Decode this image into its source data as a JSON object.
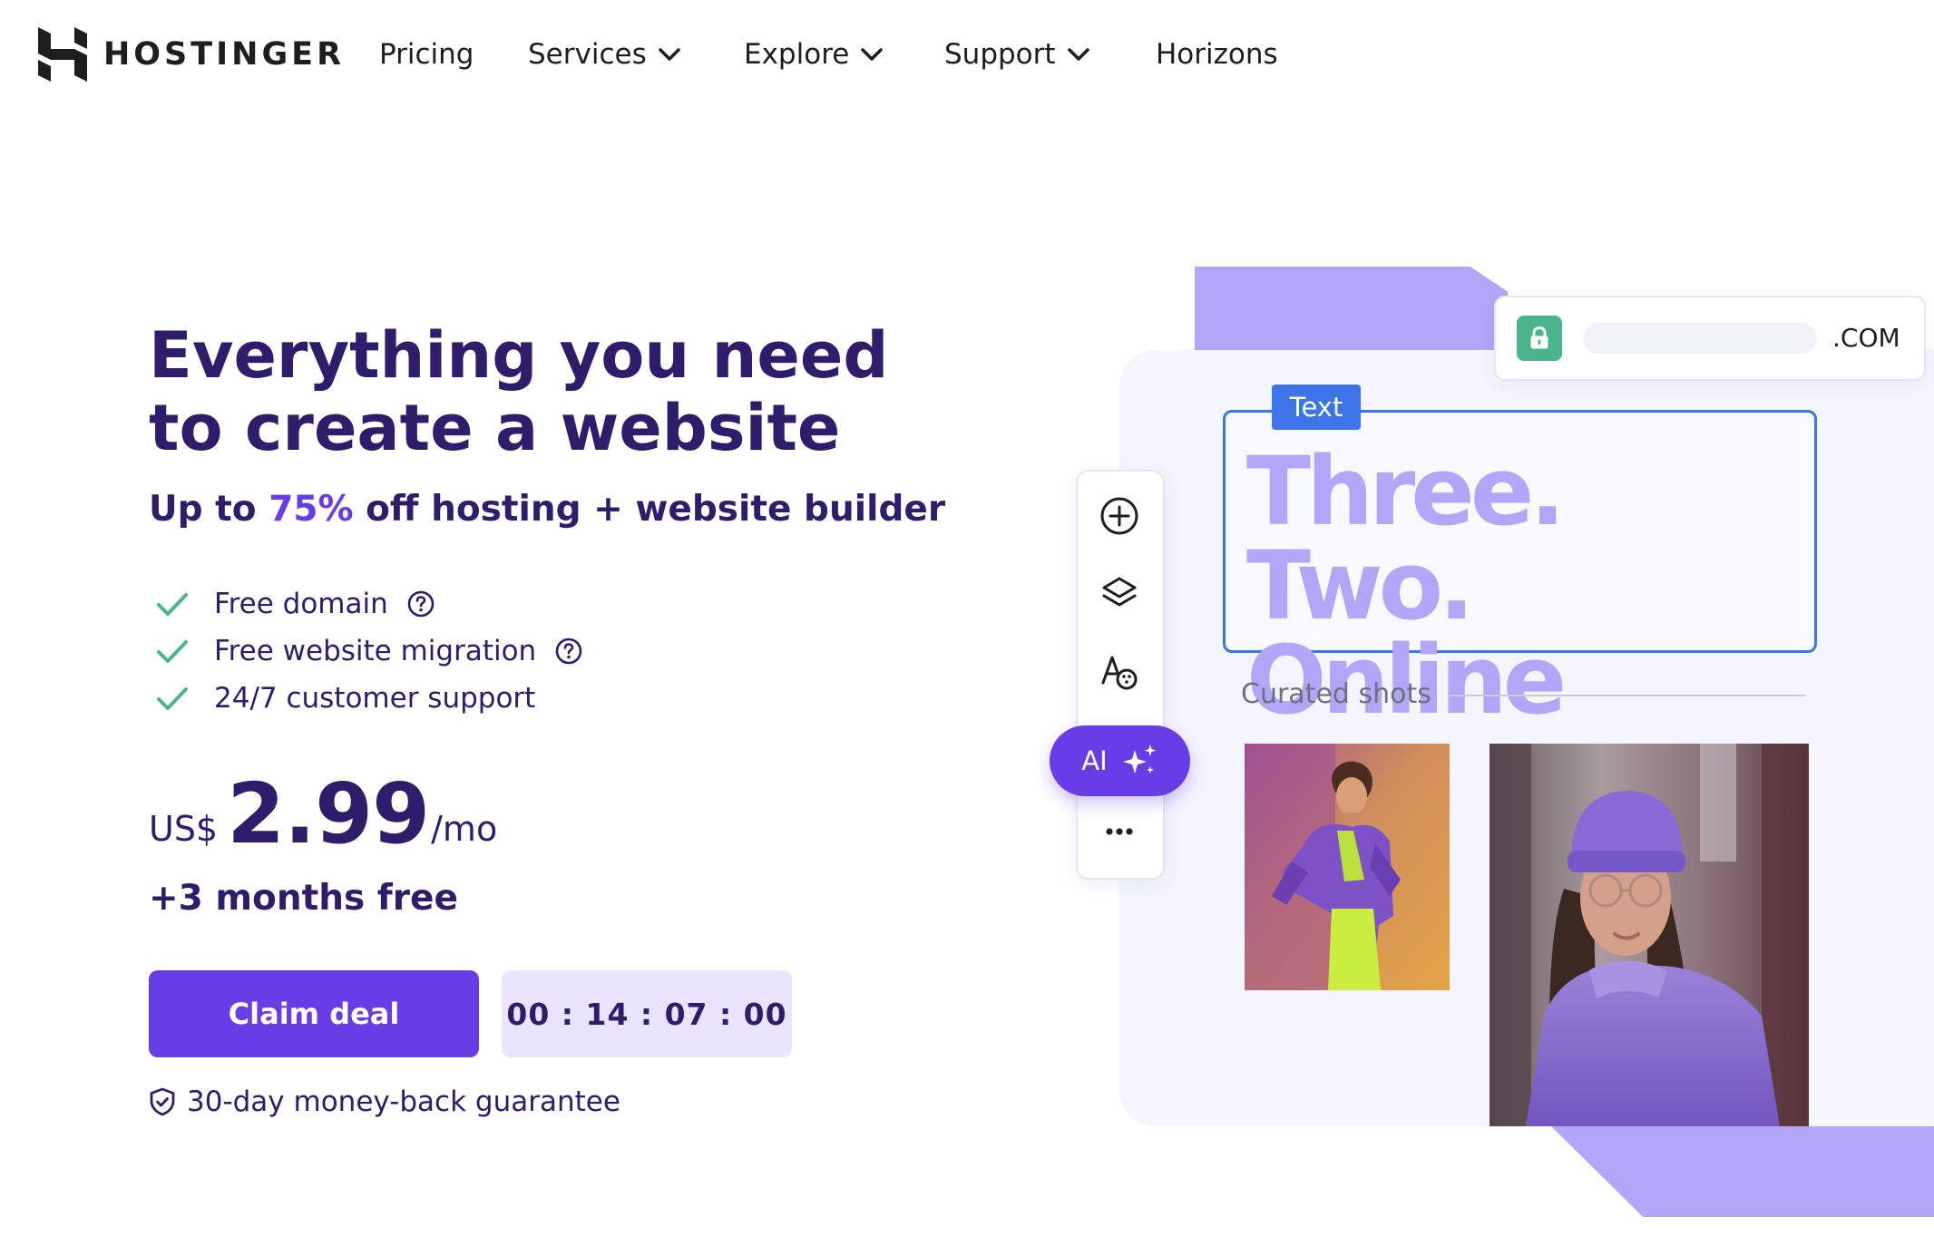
{
  "header": {
    "brand": "HOSTINGER",
    "nav": [
      {
        "label": "Pricing",
        "has_dropdown": false
      },
      {
        "label": "Services",
        "has_dropdown": true
      },
      {
        "label": "Explore",
        "has_dropdown": true
      },
      {
        "label": "Support",
        "has_dropdown": true
      },
      {
        "label": "Horizons",
        "has_dropdown": false
      }
    ]
  },
  "hero": {
    "title": "Everything you need to create a website",
    "subtitle_prefix": "Up to",
    "subtitle_discount": "75%",
    "subtitle_suffix": "off hosting + website builder",
    "features": [
      {
        "label": "Free domain",
        "has_help": true
      },
      {
        "label": "Free website migration",
        "has_help": true
      },
      {
        "label": "24/7 customer support",
        "has_help": false
      }
    ],
    "price": {
      "currency": "US$",
      "amount": "2.99",
      "period": "/mo"
    },
    "bonus": "+3 months free",
    "cta_label": "Claim deal",
    "countdown": "00 : 14 : 07 : 00",
    "guarantee": "30-day money-back guarantee"
  },
  "illustration": {
    "domain_tld": ".COM",
    "text_tag": "Text",
    "headline": "Three. Two. Online",
    "curated_label": "Curated shots",
    "ai_label": "AI",
    "tools": [
      "plus-circle-icon",
      "layers-icon",
      "font-palette-icon",
      "ai-sparkle-icon",
      "more-icon"
    ]
  },
  "colors": {
    "brand_purple": "#673de6",
    "dark_text": "#2f1c6a",
    "light_purple": "#b3a6f8",
    "timer_bg": "#ebe4ff",
    "check_green": "#4bb48d",
    "selection_blue": "#3c75e8"
  }
}
